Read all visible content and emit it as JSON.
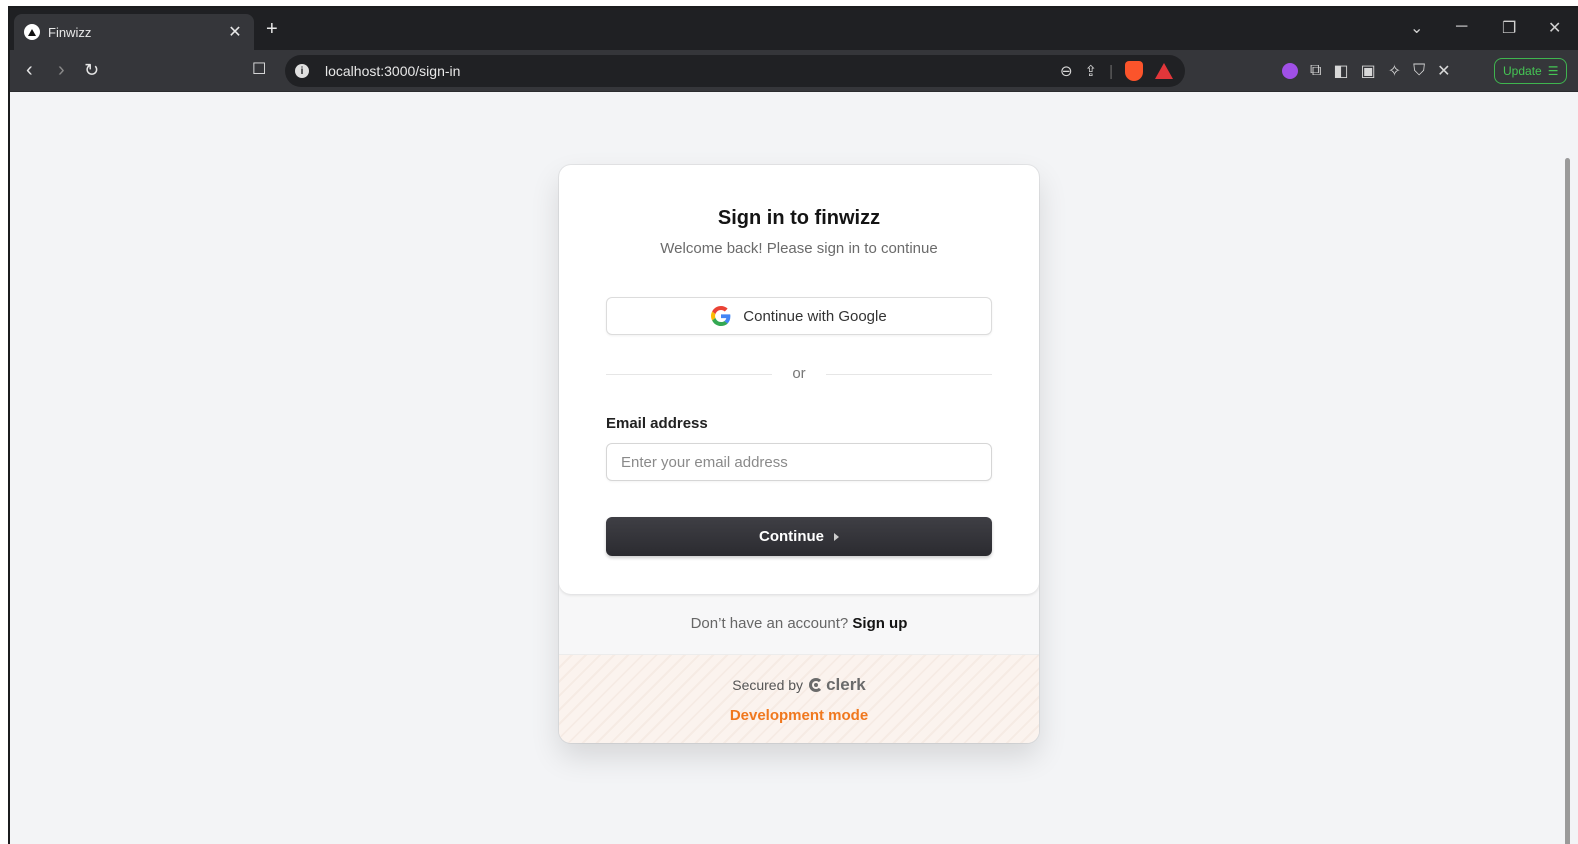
{
  "browser": {
    "tab_title": "Finwizz",
    "url": "localhost:3000/sign-in",
    "update_label": "Update"
  },
  "signin": {
    "title": "Sign in to finwizz",
    "subtitle": "Welcome back! Please sign in to continue",
    "google_button": "Continue with Google",
    "divider_text": "or",
    "email_label": "Email address",
    "email_placeholder": "Enter your email address",
    "email_value": "",
    "continue_button": "Continue",
    "footer_prompt": "Don’t have an account?",
    "signup_link": "Sign up",
    "secured_by": "Secured by",
    "clerk_brand": "clerk",
    "dev_mode": "Development mode"
  },
  "colors": {
    "dev_mode": "#f0781e",
    "primary_button": "#2f2f34",
    "update_border": "#3fb54f"
  }
}
